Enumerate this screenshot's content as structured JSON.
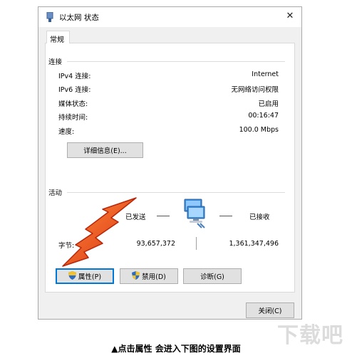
{
  "window": {
    "title": "以太网 状态",
    "close_label": "✕"
  },
  "tabs": [
    {
      "label": "常规"
    }
  ],
  "connection": {
    "group_label": "连接",
    "rows": [
      {
        "label": "IPv4 连接:",
        "value": "Internet"
      },
      {
        "label": "IPv6 连接:",
        "value": "无网络访问权限"
      },
      {
        "label": "媒体状态:",
        "value": "已启用"
      },
      {
        "label": "持续时间:",
        "value": "00:16:47"
      },
      {
        "label": "速度:",
        "value": "100.0 Mbps"
      }
    ],
    "details_button": "详细信息(E)..."
  },
  "activity": {
    "group_label": "活动",
    "sent_label": "已发送",
    "received_label": "已接收",
    "bytes_label": "字节:",
    "bytes_sent": "93,657,372",
    "bytes_received": "1,361,347,496"
  },
  "buttons": {
    "properties": "属性(P)",
    "disable": "禁用(D)",
    "diagnose": "诊断(G)",
    "close": "关闭(C)"
  },
  "caption": "▲点击属性  会进入下图的设置界面",
  "watermark": "下载吧",
  "colors": {
    "accent": "#0078d7",
    "arrow": "#e8471e",
    "shield_blue": "#2b6cc4",
    "shield_yellow": "#f2c230"
  }
}
